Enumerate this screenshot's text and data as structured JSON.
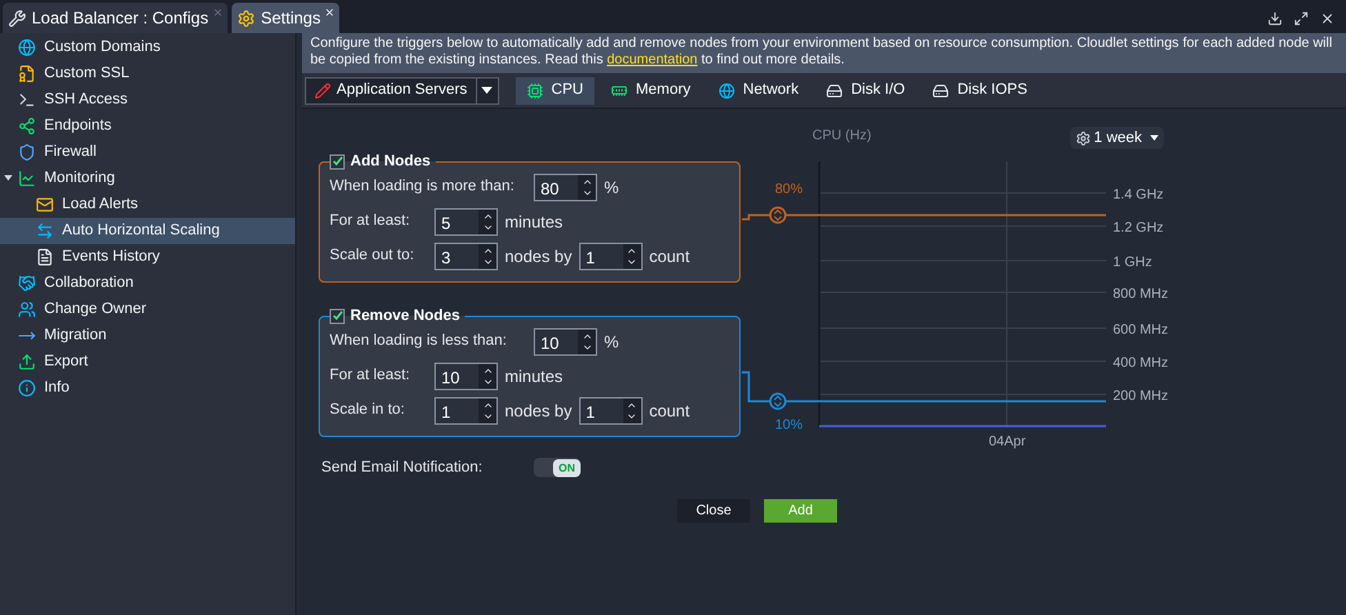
{
  "tabs": [
    {
      "label": "Load Balancer : Configs",
      "selected": false
    },
    {
      "label": "Settings",
      "selected": true
    }
  ],
  "sidebar": {
    "items": [
      {
        "label": "Custom Domains",
        "selected": false
      },
      {
        "label": "Custom SSL",
        "selected": false
      },
      {
        "label": "SSH Access",
        "selected": false
      },
      {
        "label": "Endpoints",
        "selected": false
      },
      {
        "label": "Firewall",
        "selected": false
      },
      {
        "label": "Monitoring",
        "selected": false,
        "expanded": true,
        "children": [
          {
            "label": "Load Alerts",
            "selected": false
          },
          {
            "label": "Auto Horizontal Scaling",
            "selected": true
          },
          {
            "label": "Events History",
            "selected": false
          }
        ]
      },
      {
        "label": "Collaboration",
        "selected": false
      },
      {
        "label": "Change Owner",
        "selected": false
      },
      {
        "label": "Migration",
        "selected": false
      },
      {
        "label": "Export",
        "selected": false
      },
      {
        "label": "Info",
        "selected": false
      }
    ]
  },
  "banner": {
    "before": "Configure the triggers below to automatically add and remove nodes from your environment based on resource consumption. Cloudlet settings for each added node will be copied from the existing instances. Read this ",
    "link": "documentation",
    "after": " to find out more details."
  },
  "node_group": {
    "value": "Application Servers"
  },
  "resource_tabs": [
    {
      "label": "CPU",
      "selected": true
    },
    {
      "label": "Memory",
      "selected": false
    },
    {
      "label": "Network",
      "selected": false
    },
    {
      "label": "Disk I/O",
      "selected": false
    },
    {
      "label": "Disk IOPS",
      "selected": false
    }
  ],
  "triggers": [
    {
      "title": "Add Nodes",
      "checked": true,
      "color": "#c0621e",
      "rows": [
        {
          "label": "When loading is more than:",
          "value": "80",
          "unit": "%"
        },
        {
          "label": "For at least:",
          "value": "5",
          "unit": "minutes"
        },
        {
          "label": "Scale out to:",
          "value": "3",
          "unit": "nodes by",
          "value2": "1",
          "unit2": "count"
        }
      ]
    },
    {
      "title": "Remove Nodes",
      "checked": true,
      "color": "#1e88d8",
      "rows": [
        {
          "label": "When loading is less than:",
          "value": "10",
          "unit": "%"
        },
        {
          "label": "For at least:",
          "value": "10",
          "unit": "minutes"
        },
        {
          "label": "Scale in to:",
          "value": "1",
          "unit": "nodes by",
          "value2": "1",
          "unit2": "count"
        }
      ]
    }
  ],
  "chart": {
    "title": "CPU (Hz)",
    "period": "1 week",
    "y_labels": [
      "1.4 GHz",
      "1.2 GHz",
      "1 GHz",
      "800 MHz",
      "600 MHz",
      "400 MHz",
      "200 MHz"
    ],
    "x_labels": [
      "04Apr"
    ],
    "thresholds": [
      {
        "label": "80%",
        "color": "#c0621e"
      },
      {
        "label": "10%",
        "color": "#1e88d8"
      }
    ]
  },
  "email_notification": {
    "label": "Send Email Notification:",
    "toggle": "ON",
    "on": true
  },
  "buttons": [
    {
      "label": "Close",
      "kind": "secondary"
    },
    {
      "label": "Add",
      "kind": "primary"
    }
  ]
}
